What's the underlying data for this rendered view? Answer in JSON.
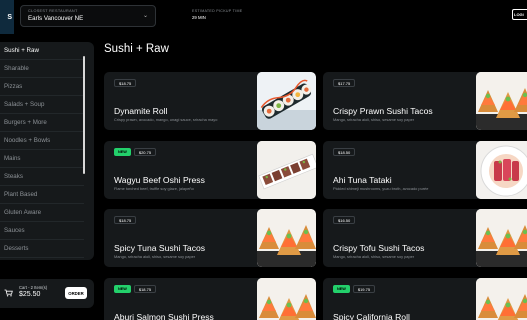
{
  "header": {
    "logo": "S",
    "restaurant_label": "CLOSEST RESTAURANT",
    "restaurant_value": "Earls Vancouver NE",
    "pickup_label": "ESTIMATED PICKUP TIME",
    "pickup_value": "29 MIN",
    "login_label": "LOGI"
  },
  "sidebar": {
    "items": [
      {
        "label": "Sushi + Raw"
      },
      {
        "label": "Sharable"
      },
      {
        "label": "Pizzas"
      },
      {
        "label": "Salads + Soup"
      },
      {
        "label": "Burgers + More"
      },
      {
        "label": "Noodles + Bowls"
      },
      {
        "label": "Mains"
      },
      {
        "label": "Steaks"
      },
      {
        "label": "Plant Based"
      },
      {
        "label": "Gluten Aware"
      },
      {
        "label": "Sauces"
      },
      {
        "label": "Desserts"
      }
    ]
  },
  "cart": {
    "items_text": "Cart - 2 Item(s)",
    "total": "$25.50",
    "order_label": "ORDER"
  },
  "main": {
    "title": "Sushi + Raw",
    "new_badge": "NEW",
    "cards": [
      {
        "name": "Dynamite Roll",
        "price": "$18.75",
        "desc": "Crispy prawn, avocado, mango, unagi sauce, sriracha mayo",
        "new": false,
        "image": "dynamite-roll"
      },
      {
        "name": "Crispy Prawn Sushi Tacos",
        "price": "$17.75",
        "desc": "Mango, sriracha aioli, shiso, sesame soy paper",
        "new": false,
        "image": "tacos"
      },
      {
        "name": "Wagyu Beef Oshi Press",
        "price": "$20.75",
        "desc": "Flame torched beef, truffle soy glaze, jalapeño",
        "new": true,
        "image": "oshi"
      },
      {
        "name": "Ahi Tuna Tataki",
        "price": "$18.50",
        "desc": "Pickled shimeji mushrooms, yuzu broth, avocado purée",
        "new": false,
        "image": "tataki"
      },
      {
        "name": "Spicy Tuna Sushi Tacos",
        "price": "$18.75",
        "desc": "Mango, sriracha aioli, shiso, sesame soy paper",
        "new": false,
        "image": "tacos"
      },
      {
        "name": "Crispy Tofu Sushi Tacos",
        "price": "$16.50",
        "desc": "Mango, sriracha aioli, shiso, sesame soy paper",
        "new": false,
        "image": "tacos"
      },
      {
        "name": "Aburi Salmon Sushi Press",
        "price": "$18.75",
        "desc": "",
        "new": true,
        "image": "tacos"
      },
      {
        "name": "Spicy California Roll",
        "price": "$19.75",
        "desc": "",
        "new": true,
        "image": "tacos"
      }
    ]
  },
  "colors": {
    "background": "#000000",
    "panel": "#16191b",
    "accent_new": "#23d06b",
    "muted_text": "#8b9095"
  }
}
